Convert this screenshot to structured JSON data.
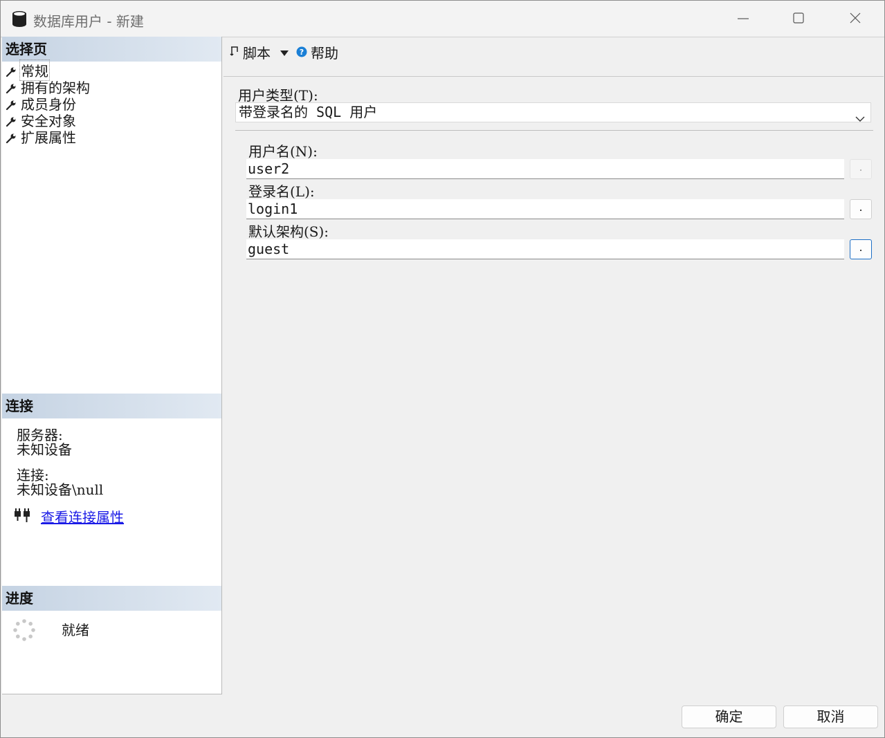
{
  "window": {
    "title": "数据库用户 - 新建"
  },
  "left": {
    "select_page_header": "选择页",
    "nav_items": [
      {
        "label": "常规"
      },
      {
        "label": "拥有的架构"
      },
      {
        "label": "成员身份"
      },
      {
        "label": "安全对象"
      },
      {
        "label": "扩展属性"
      }
    ],
    "connection_header": "连接",
    "server_label": "服务器:",
    "server_value": "未知设备",
    "connection_label": "连接:",
    "connection_value": "未知设备\\null",
    "view_connection_link": "查看连接属性",
    "progress_header": "进度",
    "progress_status": "就绪"
  },
  "toolbar": {
    "script_label": "脚本",
    "help_label": "帮助"
  },
  "form": {
    "user_type_label": "用户类型(T):",
    "user_type_value": "带登录名的 SQL 用户",
    "user_name_label": "用户名(N):",
    "user_name_value": "user2",
    "login_name_label": "登录名(L):",
    "login_name_value": "login1",
    "default_schema_label": "默认架构(S):",
    "default_schema_value": "guest",
    "browse_label": "."
  },
  "buttons": {
    "ok": "确定",
    "cancel": "取消"
  },
  "colors": {
    "section_header_start": "#c5d3e3",
    "section_header_end": "#e1e9f2",
    "link": "#1a1ae6",
    "help_icon": "#1a7fd6",
    "focus_border": "#1c6fc6"
  }
}
